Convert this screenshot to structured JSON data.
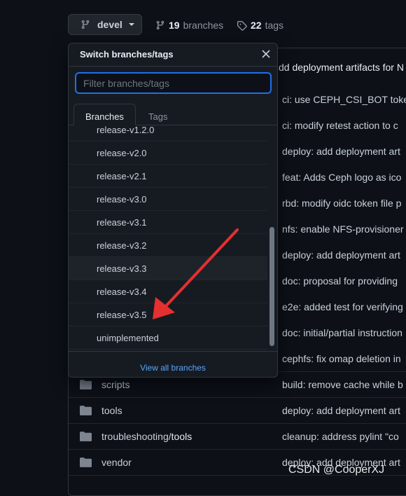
{
  "header": {
    "branch_button": {
      "label": "devel"
    },
    "branches": {
      "count": "19",
      "label": "branches"
    },
    "tags": {
      "count": "22",
      "tag_label": "tags"
    }
  },
  "dropdown": {
    "title": "Switch branches/tags",
    "filter_placeholder": "Filter branches/tags",
    "tabs": [
      {
        "label": "Branches",
        "active": true
      },
      {
        "label": "Tags",
        "active": false
      }
    ],
    "items": [
      {
        "label": "release-v1.2.0"
      },
      {
        "label": "release-v2.0"
      },
      {
        "label": "release-v2.1"
      },
      {
        "label": "release-v3.0"
      },
      {
        "label": "release-v3.1"
      },
      {
        "label": "release-v3.2"
      },
      {
        "label": "release-v3.3"
      },
      {
        "label": "release-v3.4"
      },
      {
        "label": "release-v3.5"
      },
      {
        "label": "unimplemented"
      }
    ],
    "view_all": "View all branches"
  },
  "commits": [
    "dd deployment artifacts for N",
    "ci: use CEPH_CSI_BOT toke",
    "ci: modify retest action to c",
    "deploy: add deployment art",
    "feat: Adds Ceph logo as ico",
    "rbd: modify oidc token file p",
    "nfs: enable NFS-provisioner",
    "deploy: add deployment art",
    "doc: proposal for providing",
    "e2e: added test for verifying",
    "doc: initial/partial instruction",
    "cephfs: fix omap deletion in",
    "build: remove cache while b",
    "deploy: add deployment art",
    "cleanup: address pylint \"co",
    "deploy: add deployment art"
  ],
  "files": [
    {
      "name": "scripts"
    },
    {
      "name": "tools"
    },
    {
      "prefix": "troubleshooting/",
      "name": "tools"
    },
    {
      "name": "vendor"
    }
  ],
  "watermark": "CSDN @CooperXJ",
  "colors": {
    "accent": "#58a6ff",
    "focus": "#1f6feb",
    "arrow": "#e5302f"
  }
}
